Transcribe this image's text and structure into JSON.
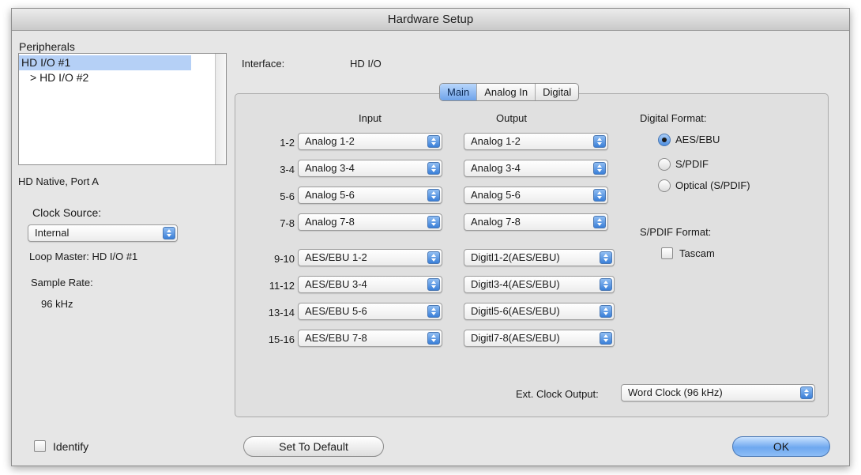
{
  "window": {
    "title": "Hardware Setup"
  },
  "sidebar": {
    "peripherals_label": "Peripherals",
    "peripherals": [
      "HD I/O #1",
      "> HD I/O #2"
    ],
    "port_label": "HD Native, Port A",
    "clock_source_label": "Clock Source:",
    "clock_source_value": "Internal",
    "loop_master": "Loop Master: HD I/O #1",
    "sample_rate_label": "Sample Rate:",
    "sample_rate_value": "96 kHz",
    "identify_label": "Identify"
  },
  "interface": {
    "label": "Interface:",
    "value": "HD I/O"
  },
  "tabs": [
    "Main",
    "Analog In",
    "Digital"
  ],
  "main": {
    "input_header": "Input",
    "output_header": "Output",
    "rows": [
      {
        "channels": "1-2",
        "input": "Analog 1-2",
        "output": "Analog 1-2"
      },
      {
        "channels": "3-4",
        "input": "Analog 3-4",
        "output": "Analog 3-4"
      },
      {
        "channels": "5-6",
        "input": "Analog 5-6",
        "output": "Analog 5-6"
      },
      {
        "channels": "7-8",
        "input": "Analog 7-8",
        "output": "Analog 7-8"
      },
      {
        "channels": "9-10",
        "input": "AES/EBU 1-2",
        "output": "Digitl1-2(AES/EBU)"
      },
      {
        "channels": "11-12",
        "input": "AES/EBU 3-4",
        "output": "Digitl3-4(AES/EBU)"
      },
      {
        "channels": "13-14",
        "input": "AES/EBU 5-6",
        "output": "Digitl5-6(AES/EBU)"
      },
      {
        "channels": "15-16",
        "input": "AES/EBU 7-8",
        "output": "Digitl7-8(AES/EBU)"
      }
    ],
    "digital_format_label": "Digital Format:",
    "digital_format_options": [
      "AES/EBU",
      "S/PDIF",
      "Optical (S/PDIF)"
    ],
    "digital_format_selected": "AES/EBU",
    "spdif_format_label": "S/PDIF Format:",
    "tascam_label": "Tascam",
    "ext_clock_label": "Ext. Clock Output:",
    "ext_clock_value": "Word Clock (96 kHz)"
  },
  "footer": {
    "default_button": "Set To Default",
    "ok_button": "OK"
  }
}
